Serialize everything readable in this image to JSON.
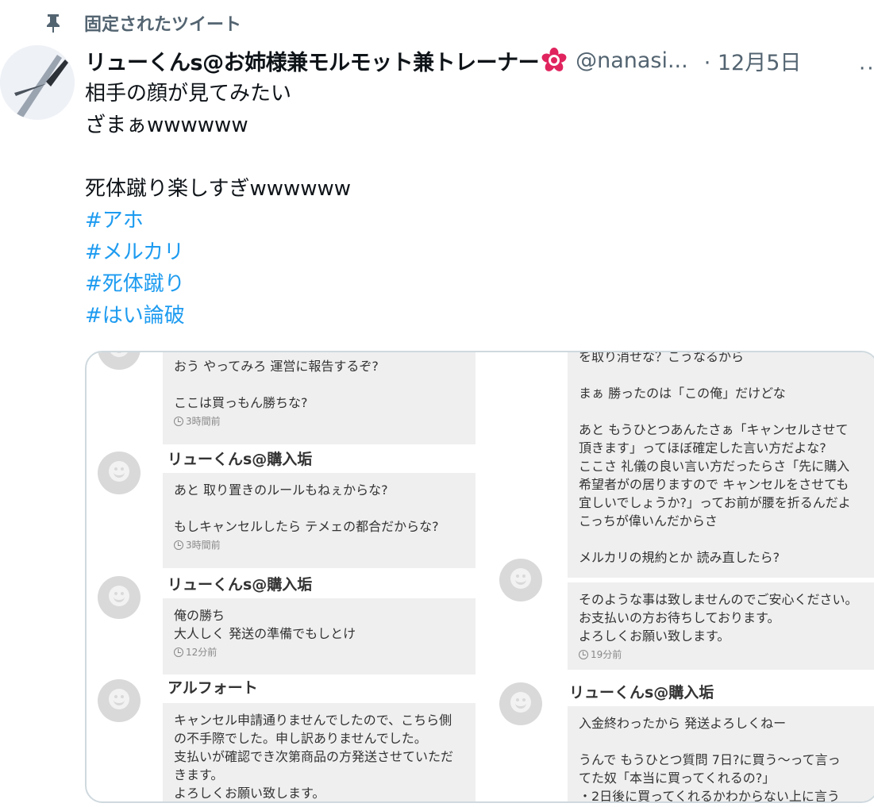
{
  "pinned": {
    "label": "固定されたツイート"
  },
  "tweet": {
    "display_name": "リューくんs@お姉様兼モルモット兼トレーナー",
    "handle": "@nanasi...",
    "date": "· 12月5日",
    "more": "··",
    "lines": [
      "相手の顔が見てみたい",
      "ざまぁwwwwww",
      "",
      "死体蹴り楽しすぎwwwwww"
    ],
    "hashtags": [
      "#アホ",
      "#メルカリ",
      "#死体蹴り",
      "#はい論破"
    ]
  },
  "media": {
    "left": {
      "m1": {
        "lines": [
          "おう やってみろ 運営に報告するぞ?",
          "",
          "ここは買っもん勝ちな?"
        ],
        "time": "3時間前"
      },
      "m2": {
        "name": "リューくんs@購入垢",
        "lines": [
          "あと 取り置きのルールもねぇからな?",
          "",
          "もしキャンセルしたら テメェの都合だからな?"
        ],
        "time": "3時間前"
      },
      "m3": {
        "name": "リューくんs@購入垢",
        "lines": [
          "俺の勝ち",
          "大人しく 発送の準備でもしとけ"
        ],
        "time": "12分前"
      },
      "m4": {
        "name": "アルフォート",
        "lines": [
          "キャンセル申請通りませんでしたので、こちら側",
          "の不手際でした。申し訳ありませんでした。",
          "支払いが確認でき次第商品の方発送させていただ",
          "きます。",
          "よろしくお願い致します。"
        ]
      }
    },
    "right": {
      "m1": {
        "lines": [
          "を取り消せな？こうなるから",
          "",
          "まぁ 勝ったのは「この俺」だけどな",
          "",
          "あと もうひとつあんたさぁ「キャンセルさせて",
          "頂きます」ってほぼ確定した言い方だよな?",
          "ここさ 礼儀の良い言い方だったらさ「先に購入",
          "希望者がの居りますので キャンセルをさせても",
          "宜しいでしょうか?」ってお前が腰を折るんだよ",
          "こっちが偉いんだからさ",
          "",
          "メルカリの規約とか 読み直したら?"
        ]
      },
      "m2": {
        "lines": [
          "そのような事は致しませんのでご安心ください。",
          "お支払いの方お待ちしております。",
          "よろしくお願い致します。"
        ],
        "time": "19分前"
      },
      "m3": {
        "name": "リューくんs@購入垢",
        "lines": [
          "入金終わったから 発送よろしくねー",
          "",
          "うんで もうひとつ質問 7日?に買う〜って言っ",
          "てた奴「本当に買ってくれるの?」",
          "・2日後に買ってくれるかわからない上に言う"
        ]
      }
    }
  }
}
